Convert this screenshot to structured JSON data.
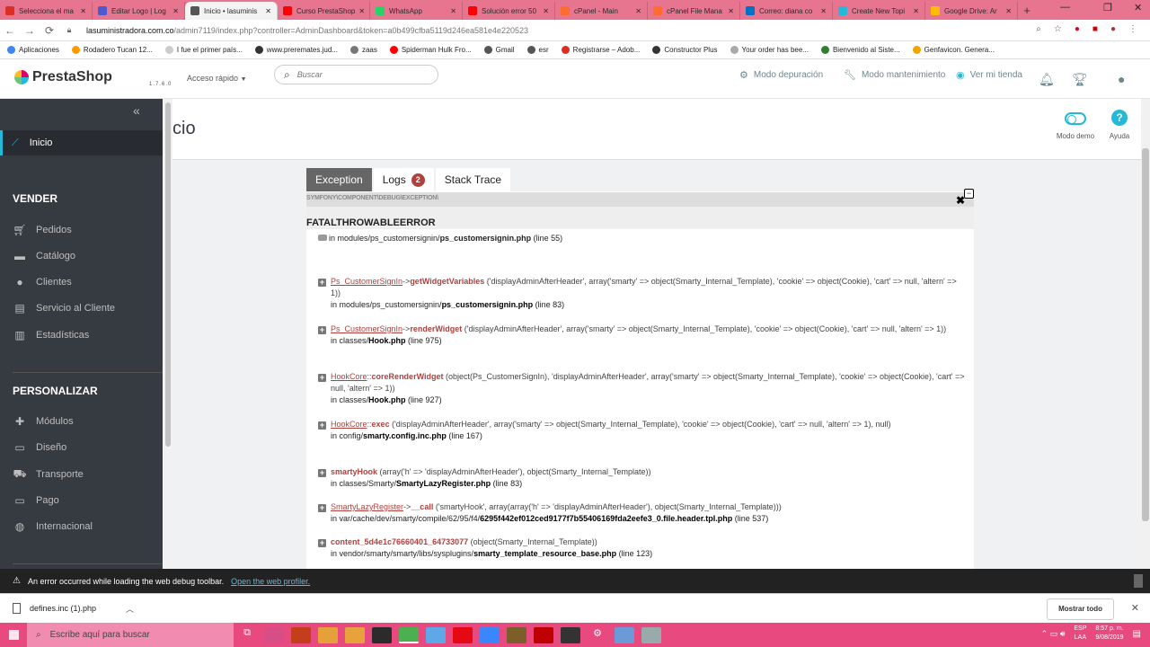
{
  "browser": {
    "tabs": [
      {
        "title": "Selecciona el ma",
        "color": "#d93025"
      },
      {
        "title": "Editar Logo | Log",
        "color": "#4b5bcf"
      },
      {
        "title": "Inicio • lasuminis",
        "color": "#555555",
        "active": true
      },
      {
        "title": "Curso PrestaShop",
        "color": "#ff0000"
      },
      {
        "title": "WhatsApp",
        "color": "#25d366"
      },
      {
        "title": "Solución error 50",
        "color": "#ff0000"
      },
      {
        "title": "cPanel - Main",
        "color": "#ff6c2c"
      },
      {
        "title": "cPanel File Mana",
        "color": "#ff6c2c"
      },
      {
        "title": "Correo: diana co",
        "color": "#0072c6"
      },
      {
        "title": "Create New Topi",
        "color": "#25b9d7"
      },
      {
        "title": "Google Drive: Ar",
        "color": "#fbbc04"
      }
    ],
    "new_tab": "+",
    "url_host": "lasuministradora.com.co",
    "url_path": "/admin7119/index.php?controller=AdminDashboard&token=a0b499cfba5119d246ea581e4e220523",
    "bookmarks": [
      {
        "label": "Aplicaciones",
        "color": "#4285f4"
      },
      {
        "label": "Rodadero Tucan 12...",
        "color": "#ff9900"
      },
      {
        "label": "I fue el primer país...",
        "color": "#cccccc"
      },
      {
        "label": "www.preremates.jud...",
        "color": "#333333"
      },
      {
        "label": "zaas",
        "color": "#777777"
      },
      {
        "label": "Spiderman Hulk Fro...",
        "color": "#ff0000"
      },
      {
        "label": "Gmail",
        "color": "#555555"
      },
      {
        "label": "esr",
        "color": "#555555"
      },
      {
        "label": "Registrarse – Adob...",
        "color": "#e02b20"
      },
      {
        "label": "Constructor Plus",
        "color": "#333333"
      },
      {
        "label": "Your order has bee...",
        "color": "#aaaaaa"
      },
      {
        "label": "Bienvenido al Siste...",
        "color": "#2e7d32"
      },
      {
        "label": "Genfavicon. Genera...",
        "color": "#f4a300"
      }
    ]
  },
  "header": {
    "logo": "PrestaShop",
    "version": "1.7.6.0",
    "quick_access": "Acceso rápido",
    "search_placeholder": "Buscar",
    "debug_mode": "Modo depuración",
    "maintenance_mode": "Modo mantenimiento",
    "view_shop": "Ver mi tienda"
  },
  "sidebar": {
    "home": "Inicio",
    "section_sell": "VENDER",
    "sell_items": [
      "Pedidos",
      "Catálogo",
      "Clientes",
      "Servicio al Cliente",
      "Estadísticas"
    ],
    "section_customize": "PERSONALIZAR",
    "customize_items": [
      "Módulos",
      "Diseño",
      "Transporte",
      "Pago",
      "Internacional"
    ]
  },
  "toolbar": {
    "page_title": "cio",
    "demo_mode": "Modo demo",
    "help": "Ayuda"
  },
  "error": {
    "tabs": {
      "exception": "Exception",
      "logs": "Logs",
      "logs_count": "2",
      "stack_trace": "Stack Trace"
    },
    "namespace": "SYMFONY\\COMPONENT\\DEBUG\\EXCEPTION\\",
    "title": "FATALTHROWABLEERROR",
    "first_line": "in modules/ps_customersignin/",
    "first_file": "ps_customersignin.php",
    "first_lineno": "(line 55)",
    "frames": [
      {
        "cls": "Ps_CustomerSignIn",
        "op": "->",
        "fn": "getWidgetVariables",
        "args": "('displayAdminAfterHeader', array('smarty' => object(Smarty_Internal_Template), 'cookie' => object(Cookie), 'cart' => null, 'altern' => 1))",
        "path": "in modules/ps_customersignin/",
        "file": "ps_customersignin.php",
        "line": "(line 83)"
      },
      {
        "cls": "Ps_CustomerSignIn",
        "op": "->",
        "fn": "renderWidget",
        "args": "('displayAdminAfterHeader', array('smarty' => object(Smarty_Internal_Template), 'cookie' => object(Cookie), 'cart' => null, 'altern' => 1))",
        "path": "in classes/",
        "file": "Hook.php",
        "line": "(line 975)"
      },
      {
        "cls": "HookCore",
        "op": "::",
        "fn": "coreRenderWidget",
        "args": "(object(Ps_CustomerSignIn), 'displayAdminAfterHeader', array('smarty' => object(Smarty_Internal_Template), 'cookie' => object(Cookie), 'cart' => null, 'altern' => 1))",
        "path": "in classes/",
        "file": "Hook.php",
        "line": "(line 927)"
      },
      {
        "cls": "HookCore",
        "op": "::",
        "fn": "exec",
        "args": "('displayAdminAfterHeader', array('smarty' => object(Smarty_Internal_Template), 'cookie' => object(Cookie), 'cart' => null, 'altern' => 1), null)",
        "path": "in config/",
        "file": "smarty.config.inc.php",
        "line": "(line 167)"
      },
      {
        "cls": "",
        "op": "",
        "fn": "smartyHook",
        "args": "(array('h' => 'displayAdminAfterHeader'), object(Smarty_Internal_Template))",
        "path": "in classes/Smarty/",
        "file": "SmartyLazyRegister.php",
        "line": "(line 83)"
      },
      {
        "cls": "SmartyLazyRegister",
        "op": "->",
        "fn": "__call",
        "args": "('smartyHook', array(array('h' => 'displayAdminAfterHeader'), object(Smarty_Internal_Template)))",
        "path": "in var/cache/dev/smarty/compile/62/95/f4/",
        "file": "6295f442ef012ced9177f7b55406169fda2eefe3_0.file.header.tpl.php",
        "line": "(line 537)"
      },
      {
        "cls": "",
        "op": "",
        "fn": "content_5d4e1c76660401_64733077",
        "args": "(object(Smarty_Internal_Template))",
        "path": "in vendor/smarty/smarty/libs/sysplugins/",
        "file": "smarty_template_resource_base.php",
        "line": "(line 123)"
      }
    ]
  },
  "debug_bar": {
    "message": "An error occurred while loading the web debug toolbar.",
    "link": "Open the web profiler."
  },
  "downloads": {
    "file": "defines.inc (1).php",
    "show_all": "Mostrar todo"
  },
  "taskbar": {
    "search_placeholder": "Escribe aquí para buscar",
    "lang_top": "ESP",
    "lang_bottom": "LAA",
    "time": "8:57 p. m.",
    "date": "9/08/2019"
  }
}
